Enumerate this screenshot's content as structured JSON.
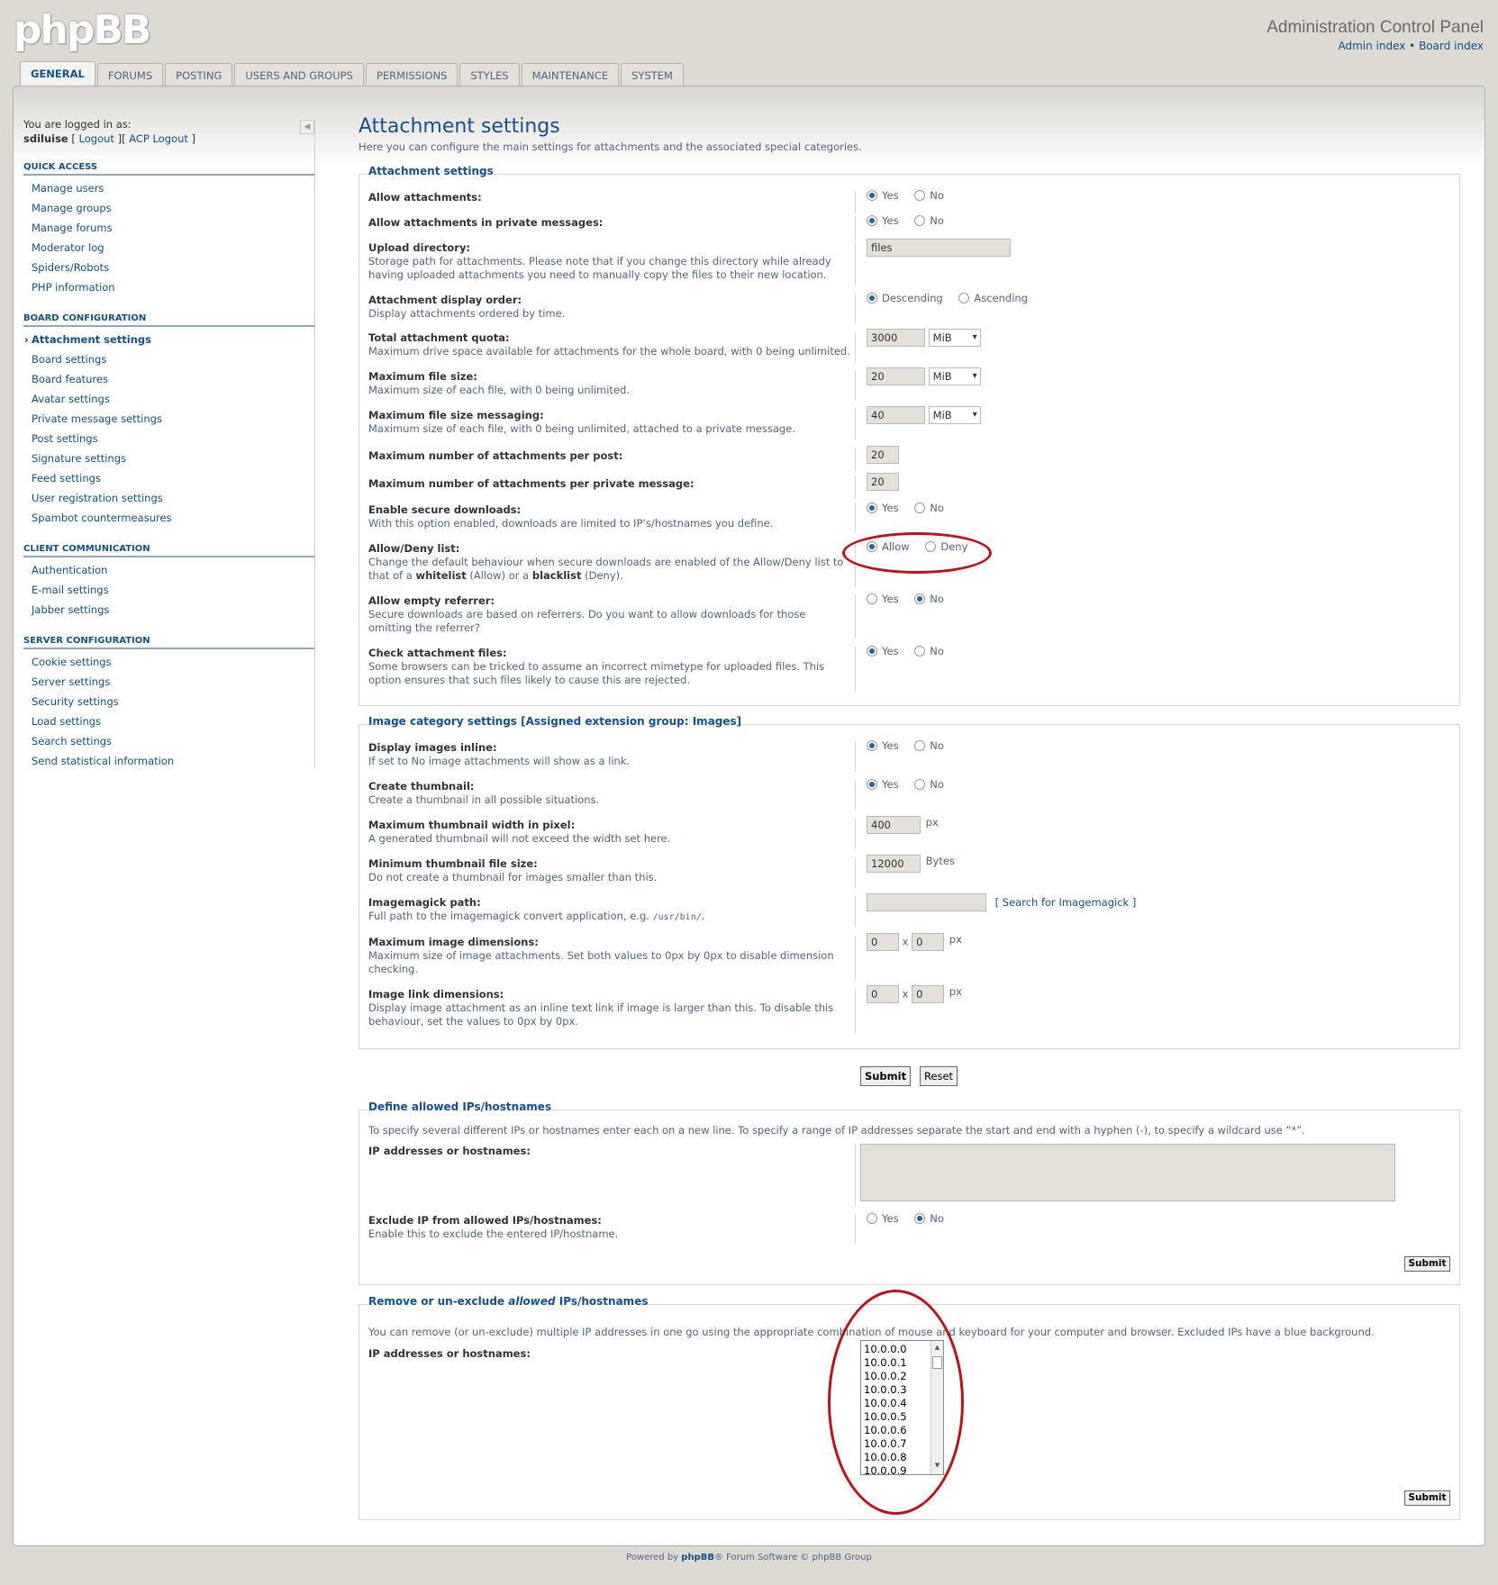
{
  "header": {
    "logo": "phpBB",
    "title": "Administration Control Panel",
    "links": [
      "Admin index",
      "Board index"
    ],
    "link_sep": "•"
  },
  "tabs": [
    "GENERAL",
    "FORUMS",
    "POSTING",
    "USERS AND GROUPS",
    "PERMISSIONS",
    "STYLES",
    "MAINTENANCE",
    "SYSTEM"
  ],
  "sidebar": {
    "logged_in_as": "You are logged in as:",
    "username": "sdiluise",
    "logout": "Logout",
    "acp_logout": "ACP Logout",
    "sections": [
      {
        "title": "QUICK ACCESS",
        "items": [
          "Manage users",
          "Manage groups",
          "Manage forums",
          "Moderator log",
          "Spiders/Robots",
          "PHP information"
        ]
      },
      {
        "title": "BOARD CONFIGURATION",
        "items": [
          "Attachment settings",
          "Board settings",
          "Board features",
          "Avatar settings",
          "Private message settings",
          "Post settings",
          "Signature settings",
          "Feed settings",
          "User registration settings",
          "Spambot countermeasures"
        ]
      },
      {
        "title": "CLIENT COMMUNICATION",
        "items": [
          "Authentication",
          "E-mail settings",
          "Jabber settings"
        ]
      },
      {
        "title": "SERVER CONFIGURATION",
        "items": [
          "Cookie settings",
          "Server settings",
          "Security settings",
          "Load settings",
          "Search settings",
          "Send statistical information"
        ]
      }
    ],
    "active_item": "Attachment settings"
  },
  "page": {
    "title": "Attachment settings",
    "intro": "Here you can configure the main settings for attachments and the associated special categories."
  },
  "attach": {
    "legend": "Attachment settings",
    "allow_attach": {
      "label": "Allow attachments:",
      "opt1": "Yes",
      "opt2": "No"
    },
    "allow_pm_attach": {
      "label": "Allow attachments in private messages:",
      "opt1": "Yes",
      "opt2": "No"
    },
    "upload_dir": {
      "label": "Upload directory:",
      "desc": "Storage path for attachments. Please note that if you change this directory while already having uploaded attachments you need to manually copy the files to their new location.",
      "value": "files"
    },
    "display_order": {
      "label": "Attachment display order:",
      "desc": "Display attachments ordered by time.",
      "opt1": "Descending",
      "opt2": "Ascending"
    },
    "quota": {
      "label": "Total attachment quota:",
      "desc": "Maximum drive space available for attachments for the whole board, with 0 being unlimited.",
      "value": "3000",
      "unit": "MiB"
    },
    "max_filesize": {
      "label": "Maximum file size:",
      "desc": "Maximum size of each file, with 0 being unlimited.",
      "value": "20",
      "unit": "MiB"
    },
    "max_filesize_pm": {
      "label": "Maximum file size messaging:",
      "desc": "Maximum size of each file, with 0 being unlimited, attached to a private message.",
      "value": "40",
      "unit": "MiB"
    },
    "max_per_post": {
      "label": "Maximum number of attachments per post:",
      "value": "20"
    },
    "max_per_pm": {
      "label": "Maximum number of attachments per private message:",
      "value": "20"
    },
    "secure_downloads": {
      "label": "Enable secure downloads:",
      "desc": "With this option enabled, downloads are limited to IP’s/hostnames you define.",
      "opt1": "Yes",
      "opt2": "No"
    },
    "allow_deny": {
      "label": "Allow/Deny list:",
      "desc1": "Change the default behaviour when secure downloads are enabled of the Allow/Deny list to that of a ",
      "whitelist": "whitelist",
      "desc2": " (Allow) or a ",
      "blacklist": "blacklist",
      "desc3": " (Deny).",
      "opt1": "Allow",
      "opt2": "Deny"
    },
    "empty_referrer": {
      "label": "Allow empty referrer:",
      "desc": "Secure downloads are based on referrers. Do you want to allow downloads for those omitting the referrer?",
      "opt1": "Yes",
      "opt2": "No"
    },
    "check_files": {
      "label": "Check attachment files:",
      "desc": "Some browsers can be tricked to assume an incorrect mimetype for uploaded files. This option ensures that such files likely to cause this are rejected.",
      "opt1": "Yes",
      "opt2": "No"
    }
  },
  "image": {
    "legend": "Image category settings [Assigned extension group: Images]",
    "inline": {
      "label": "Display images inline:",
      "desc": "If set to No image attachments will show as a link.",
      "opt1": "Yes",
      "opt2": "No"
    },
    "thumbnail": {
      "label": "Create thumbnail:",
      "desc": "Create a thumbnail in all possible situations.",
      "opt1": "Yes",
      "opt2": "No"
    },
    "thumb_width": {
      "label": "Maximum thumbnail width in pixel:",
      "desc": "A generated thumbnail will not exceed the width set here.",
      "value": "400",
      "unit": "px"
    },
    "thumb_size": {
      "label": "Minimum thumbnail file size:",
      "desc": "Do not create a thumbnail for images smaller than this.",
      "value": "12000",
      "unit": "Bytes"
    },
    "imagick": {
      "label": "Imagemagick path:",
      "desc1": "Full path to the imagemagick convert application, e.g. ",
      "code": "/usr/bin/",
      "desc2": ".",
      "value": "",
      "link": "[ Search for Imagemagick ]"
    },
    "max_dim": {
      "label": "Maximum image dimensions:",
      "desc": "Maximum size of image attachments. Set both values to 0px by 0px to disable dimension checking.",
      "w": "0",
      "h": "0",
      "x": "x",
      "unit": "px"
    },
    "link_dim": {
      "label": "Image link dimensions:",
      "desc": "Display image attachment as an inline text link if image is larger than this. To disable this behaviour, set the values to 0px by 0px.",
      "w": "0",
      "h": "0",
      "x": "x",
      "unit": "px"
    }
  },
  "buttons": {
    "submit": "Submit",
    "reset": "Reset"
  },
  "allowed_ips": {
    "legend": "Define allowed IPs/hostnames",
    "desc": "To specify several different IPs or hostnames enter each on a new line. To specify a range of IP addresses separate the start and end with a hyphen (-), to specify a wildcard use “*”.",
    "ip_label": "IP addresses or hostnames:",
    "textarea_value": "",
    "exclude": {
      "label": "Exclude IP from allowed IPs/hostnames:",
      "desc": "Enable this to exclude the entered IP/hostname.",
      "opt1": "Yes",
      "opt2": "No"
    },
    "submit": "Submit"
  },
  "remove_ips": {
    "legend_pre": "Remove or un-exclude ",
    "legend_em": "allowed",
    "legend_post": " IPs/hostnames",
    "desc": "You can remove (or un-exclude) multiple IP addresses in one go using the appropriate combination of mouse and keyboard for your computer and browser. Excluded IPs have a blue background.",
    "ip_label": "IP addresses or hostnames:",
    "ips": [
      "10.0.0.0",
      "10.0.0.1",
      "10.0.0.2",
      "10.0.0.3",
      "10.0.0.4",
      "10.0.0.5",
      "10.0.0.6",
      "10.0.0.7",
      "10.0.0.8",
      "10.0.0.9"
    ],
    "submit": "Submit"
  },
  "footer": {
    "pre": "Powered by ",
    "brand": "phpBB",
    "post": "® Forum Software © phpBB Group"
  },
  "colors": {
    "link": "#105289",
    "heading": "#115098",
    "annotation": "#c0101a"
  }
}
